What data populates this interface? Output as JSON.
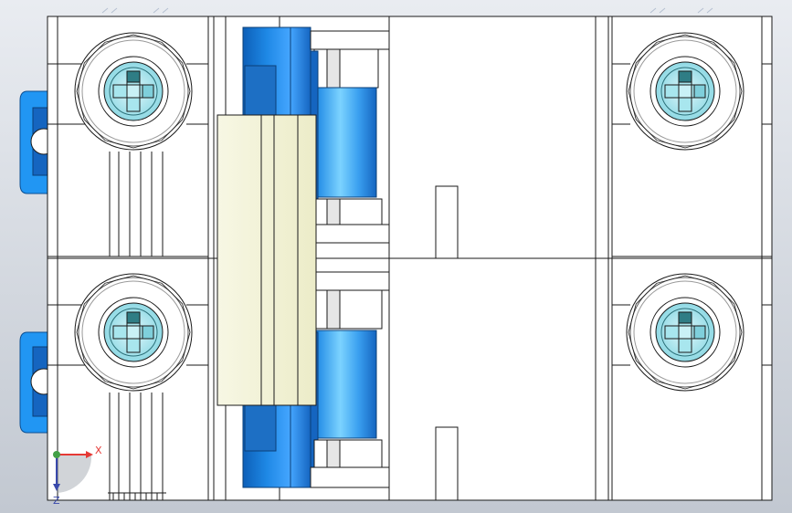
{
  "viewport": {
    "background_top": "#e9ecf1",
    "background_bottom": "#c2c8d1",
    "part_fill": "#ffffff",
    "edge_color": "#1a1a1a",
    "accent_blue": "#1e88e5",
    "clip_blue": "#2196f3",
    "screw_cyan": "#a8e6ee",
    "slot_teal": "#2f7d85",
    "lever_fill": "#f5f5dc"
  },
  "triad": {
    "x_label": "X",
    "y_label": "Z",
    "x_color": "#e53935",
    "y_color": "#3949ab",
    "origin_color": "#43a047"
  },
  "screws": {
    "icon": "phillips-screw-icon",
    "count": 4
  }
}
